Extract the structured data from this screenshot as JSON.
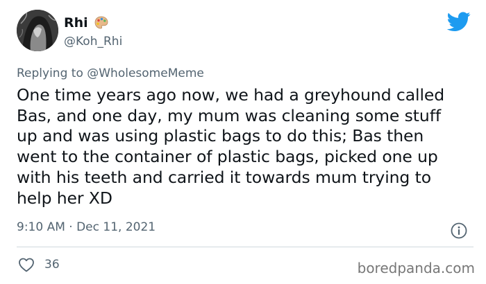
{
  "author": {
    "name": "Rhi",
    "handle": "@Koh_Rhi",
    "name_emoji_icon": "artist-palette-icon"
  },
  "reply": {
    "prefix": "Replying to",
    "mention": "@WholesomeMeme"
  },
  "tweet": {
    "text": "One time years ago now, we had a greyhound called Bas, and one day, my mum was cleaning some stuff up and was using plastic bags to do this; Bas then went to the container of plastic bags, picked one up with his teeth and carried it towards mum trying to help her XD",
    "timestamp": "9:10 AM · Dec 11, 2021"
  },
  "engagement": {
    "likes": "36"
  },
  "watermark": "boredpanda.com",
  "colors": {
    "twitter_blue": "#1d9bf0",
    "secondary_text": "#536471",
    "primary_text": "#0f1419"
  },
  "icons": [
    "twitter-bird-icon",
    "info-icon",
    "heart-icon",
    "artist-palette-icon"
  ]
}
